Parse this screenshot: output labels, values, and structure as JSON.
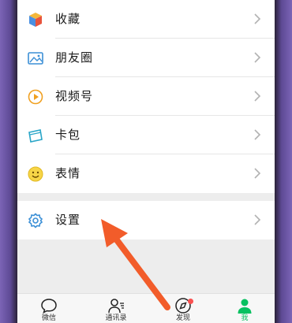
{
  "menu": {
    "items": [
      {
        "label": "收藏",
        "icon": "favorites-cube-icon"
      },
      {
        "label": "朋友圈",
        "icon": "moments-picture-icon"
      },
      {
        "label": "视频号",
        "icon": "channels-play-icon"
      },
      {
        "label": "卡包",
        "icon": "card-wallet-icon"
      },
      {
        "label": "表情",
        "icon": "sticker-smile-icon"
      }
    ],
    "settings": {
      "label": "设置",
      "icon": "gear-icon"
    }
  },
  "tabbar": {
    "tabs": [
      {
        "label": "微信",
        "icon": "chat-bubble-icon"
      },
      {
        "label": "通讯录",
        "icon": "contacts-icon"
      },
      {
        "label": "发现",
        "icon": "compass-icon"
      },
      {
        "label": "我",
        "icon": "person-icon",
        "active": true
      }
    ]
  },
  "colors": {
    "accent": "#07c160",
    "arrow": "#f25c2a",
    "badge": "#fa5151"
  }
}
